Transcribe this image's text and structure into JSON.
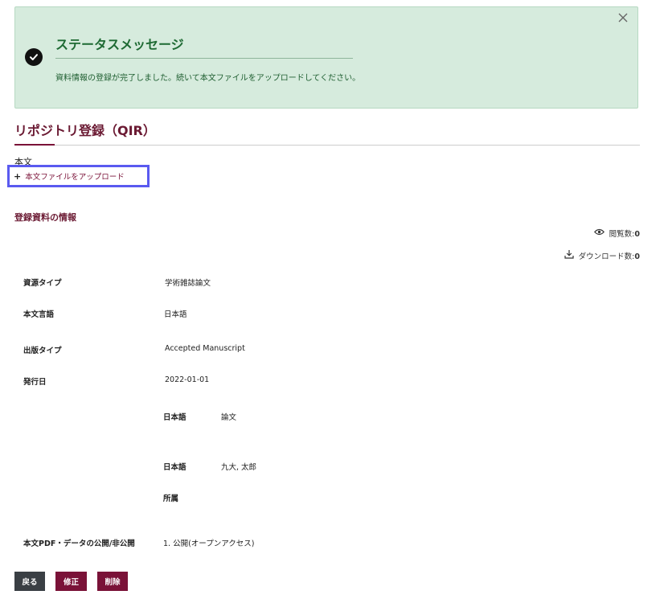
{
  "alert": {
    "title": "ステータスメッセージ",
    "message": "資料情報の登録が完了しました。続いて本文ファイルをアップロードしてください。",
    "close_icon": "close-icon",
    "status_icon": "check-circle-icon"
  },
  "page": {
    "title": "リポジトリ登録（QIR）"
  },
  "body_section": {
    "heading": "本文",
    "upload_label": "本文ファイルをアップロード",
    "upload_icon": "plus-icon"
  },
  "info_section": {
    "heading": "登録資料の情報",
    "views_label": "閲覧数:",
    "views_value": "0",
    "downloads_label": "ダウンロード数:",
    "downloads_value": "0"
  },
  "fields": [
    {
      "label": "資源タイプ",
      "value": "学術雑誌論文"
    },
    {
      "label": "本文言語",
      "value": "日本語"
    },
    {
      "label": "出版タイプ",
      "value": "Accepted Manuscript"
    },
    {
      "label": "発行日",
      "value": "2022-01-01"
    },
    {
      "label": "本文PDF・データの公開/非公開",
      "value": "1. 公開(オープンアクセス)"
    }
  ],
  "title_block": {
    "lang": "日本語",
    "value": "論文"
  },
  "creator_block": {
    "lang": "日本語",
    "value": "九大, 太郎",
    "affiliation_label": "所属"
  },
  "buttons": {
    "back": "戻る",
    "edit": "修正",
    "delete": "削除"
  },
  "colors": {
    "accent": "#7a1238",
    "alert_bg": "#d6ebdd",
    "alert_text": "#1e6a33",
    "back_button": "#3a3f44"
  }
}
